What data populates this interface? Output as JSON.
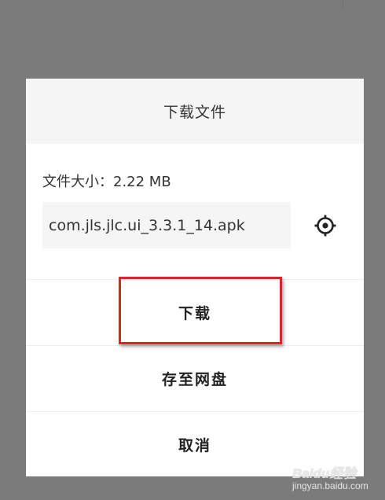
{
  "dialog": {
    "title": "下载文件",
    "file_size_label": "文件大小：2.22 MB",
    "filename": "com.jls.jlc.ui_3.3.1_14.apk",
    "settings_icon": "gear-icon",
    "actions": {
      "download": "下载",
      "save_to_cloud": "存至网盘",
      "cancel": "取消"
    }
  },
  "highlight": {
    "color": "#d3272c"
  },
  "watermark": {
    "logo_text": "Baidu经验",
    "url": "jingyan.baidu.com"
  }
}
